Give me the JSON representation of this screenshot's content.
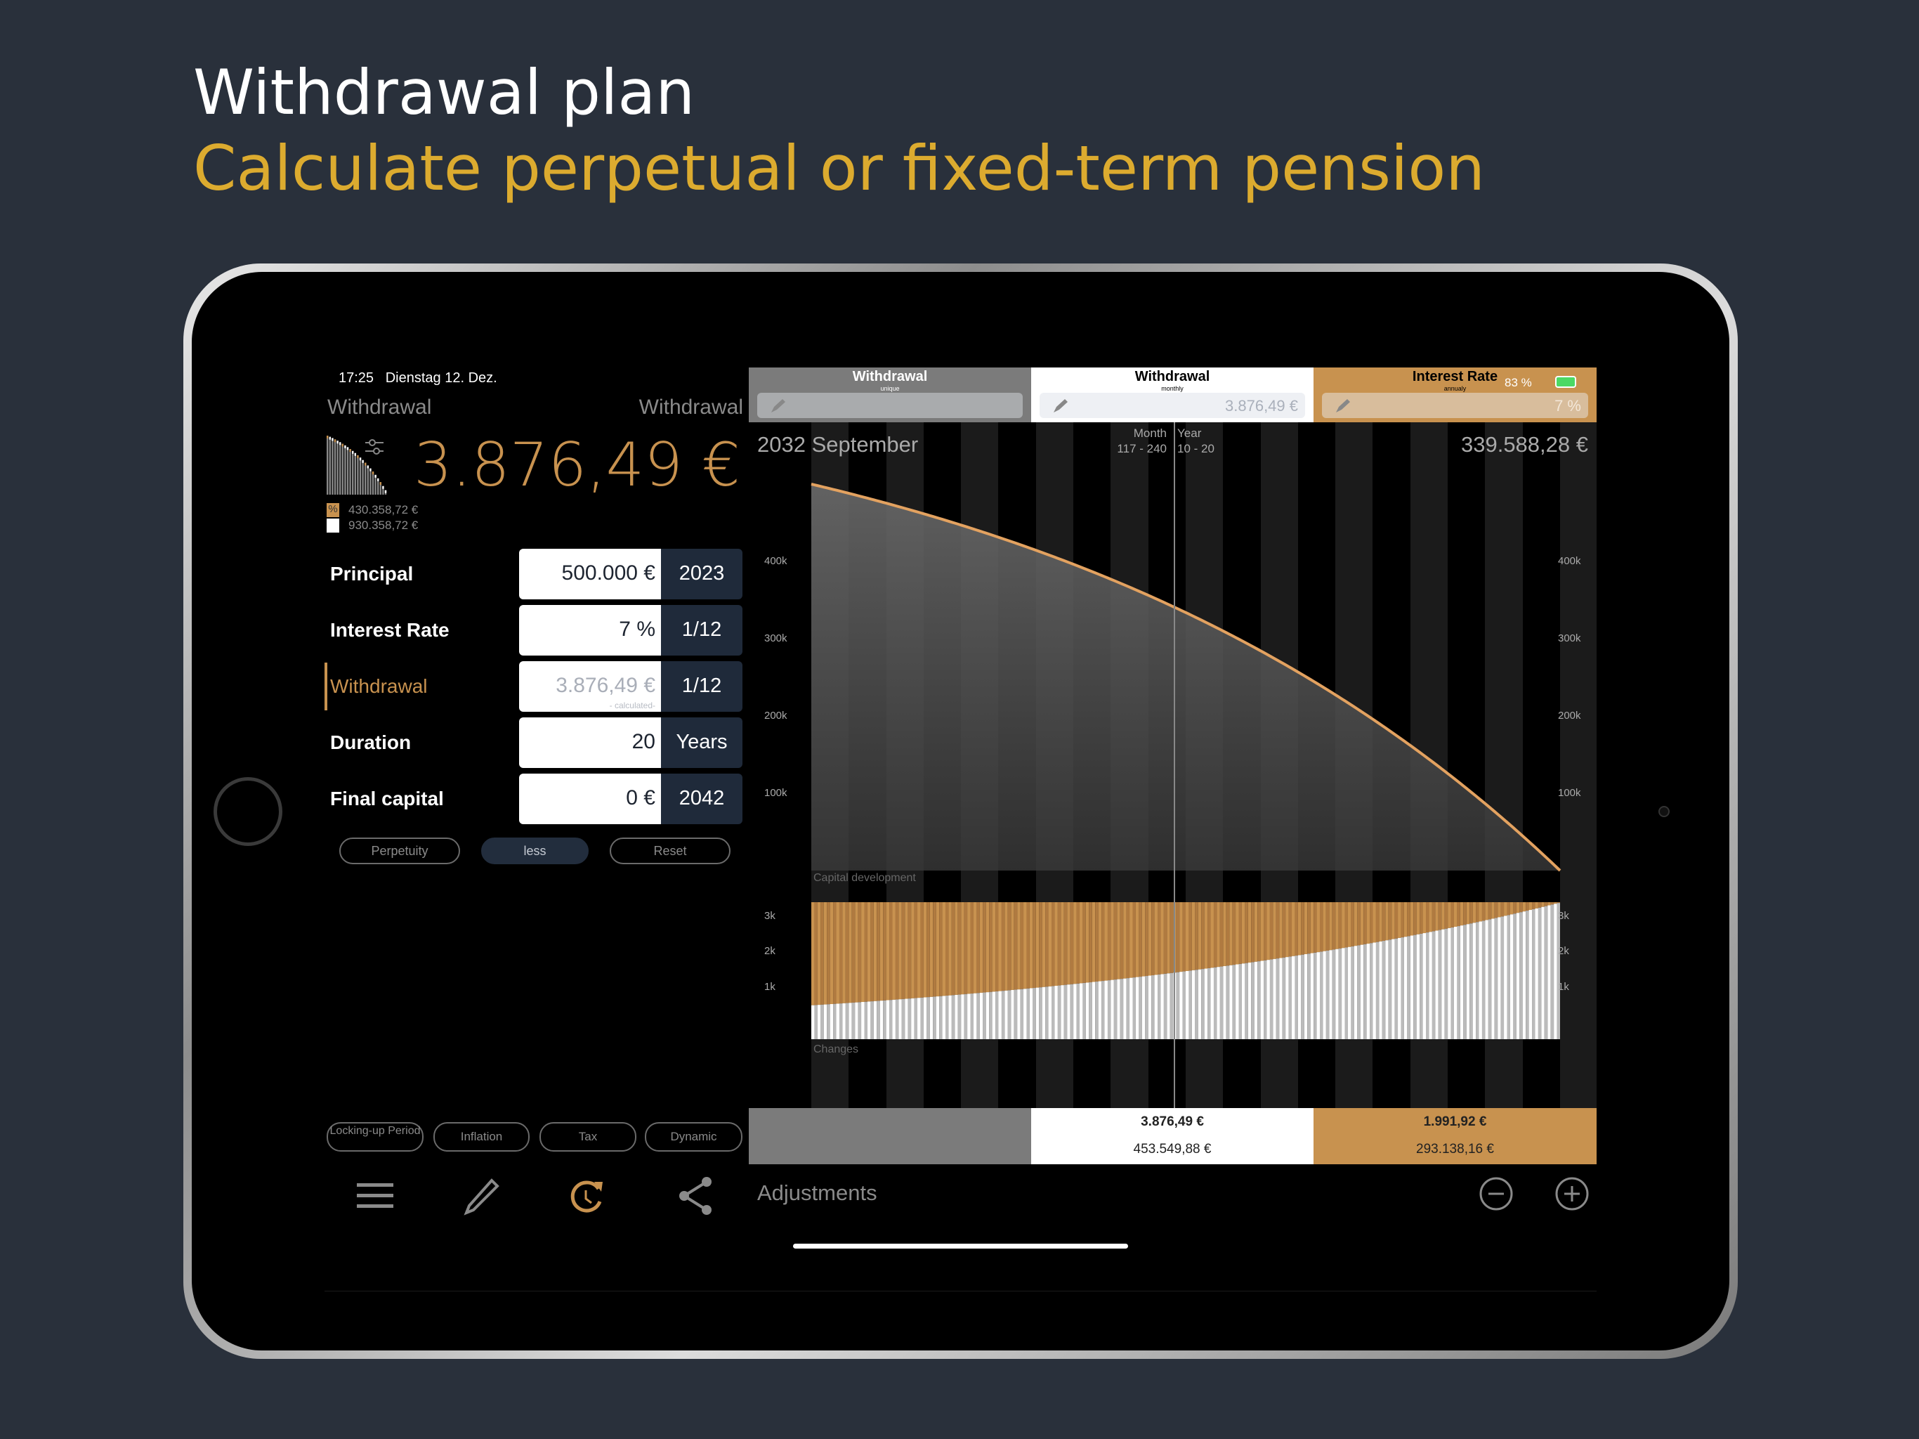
{
  "promo": {
    "title": "Withdrawal plan",
    "subtitle": "Calculate perpetual or fixed-term pension"
  },
  "status": {
    "time_date": "17:25   Dienstag 12. Dez.",
    "battery": "83 %"
  },
  "left": {
    "label_left": "Withdrawal",
    "label_right": "Withdrawal",
    "result_value": "3.876,49 €",
    "legend": [
      {
        "icon": "%",
        "value": "430.358,72 €"
      },
      {
        "icon": "",
        "value": "930.358,72 €"
      }
    ],
    "rows": [
      {
        "name": "Principal",
        "value": "500.000 €",
        "unit": "2023"
      },
      {
        "name": "Interest Rate",
        "value": "7 %",
        "unit": "1/12"
      },
      {
        "name": "Withdrawal",
        "value": "3.876,49 €",
        "note": "- calculated-",
        "unit": "1/12",
        "active": true
      },
      {
        "name": "Duration",
        "value": "20",
        "unit": "Years"
      },
      {
        "name": "Final capital",
        "value": "0 €",
        "unit": "2042"
      }
    ],
    "buttons": {
      "perpetuity": "Perpetuity",
      "less": "less",
      "reset": "Reset"
    },
    "options": [
      "Locking-up Period",
      "Inflation",
      "Tax",
      "Dynamic"
    ]
  },
  "toolbar": {
    "icons": [
      "menu-icon",
      "pencil-icon",
      "history-icon",
      "share-icon"
    ],
    "adjustments": "Adjustments"
  },
  "right": {
    "headers": [
      {
        "title": "Withdrawal",
        "sub": "unique",
        "field": ""
      },
      {
        "title": "Withdrawal",
        "sub": "monthly",
        "field": "3.876,49 €"
      },
      {
        "title": "Interest Rate",
        "sub": "annualy",
        "field": "7 %"
      }
    ],
    "date": "2032 September",
    "month_label": "Month",
    "month_range": "117 - 240",
    "year_label": "Year",
    "year_range": "10 - 20",
    "capital": "339.588,28 €",
    "summary": [
      {
        "top": "",
        "bottom": ""
      },
      {
        "top": "3.876,49 €",
        "bottom": "453.549,88 €"
      },
      {
        "top": "1.991,92 €",
        "bottom": "293.138,16 €"
      }
    ]
  },
  "colors": {
    "accent": "#c8924f",
    "navy": "#1f2a3a",
    "promo_gold": "#dcab2f",
    "bg": "#29303b"
  },
  "chart_data": [
    {
      "type": "area",
      "label": "Capital development",
      "yticks": [
        "400k",
        "300k",
        "200k",
        "100k"
      ],
      "ylim": [
        0,
        500000
      ],
      "model": {
        "principal": 500000,
        "annual_rate": 0.07,
        "monthly_withdrawal": 3876.49,
        "months": 240,
        "final_capital": 0
      }
    },
    {
      "type": "bar",
      "label": "Changes",
      "yticks": [
        "3k",
        "2k",
        "1k"
      ],
      "stacked": [
        "principal",
        "interest"
      ],
      "model": {
        "principal": 500000,
        "annual_rate": 0.07,
        "monthly_withdrawal": 3876.49,
        "months": 240
      }
    }
  ]
}
